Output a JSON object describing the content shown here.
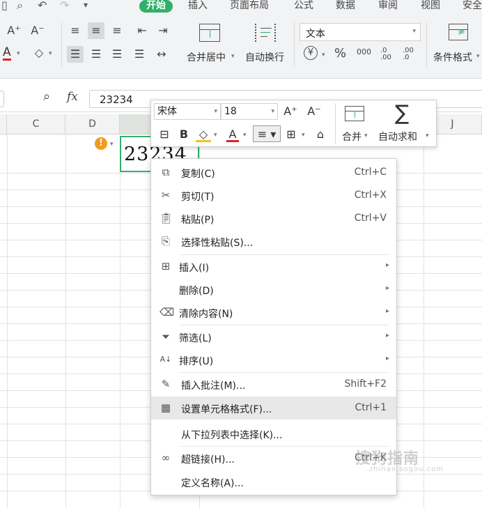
{
  "menu_bar": {
    "tabs": [
      "开始",
      "插入",
      "页面布局",
      "公式",
      "数据",
      "审阅",
      "视图",
      "安全"
    ]
  },
  "ribbon": {
    "merge_label": "合并居中",
    "wrap_label": "自动换行",
    "number_format": "文本",
    "percent": "%",
    "comma": "000",
    "inc_decimal": ".0 .00",
    "dec_decimal": ".00 .0",
    "cond_format_label": "条件格式",
    "font_color_letter": "A",
    "font_inc": "A⁺",
    "font_dec": "A⁻",
    "currency": "¥"
  },
  "formula_bar": {
    "fx": "fx",
    "value": "23234"
  },
  "columns": [
    "C",
    "D",
    "",
    "",
    "",
    "",
    "",
    "",
    "J"
  ],
  "cell": {
    "value": "23234",
    "warning": "!"
  },
  "mini_toolbar": {
    "font_name": "宋体",
    "font_size": "18",
    "merge_label": "合并",
    "autosum_label": "自动求和",
    "bold": "B",
    "font_color": "A",
    "sum_symbol": "∑"
  },
  "context_menu": {
    "items": [
      {
        "label": "复制(C)",
        "shortcut": "Ctrl+C"
      },
      {
        "label": "剪切(T)",
        "shortcut": "Ctrl+X"
      },
      {
        "label": "粘贴(P)",
        "shortcut": "Ctrl+V"
      },
      {
        "label": "选择性粘贴(S)...",
        "shortcut": ""
      },
      {
        "label": "插入(I)",
        "shortcut": ""
      },
      {
        "label": "删除(D)",
        "shortcut": ""
      },
      {
        "label": "清除内容(N)",
        "shortcut": ""
      },
      {
        "label": "筛选(L)",
        "shortcut": ""
      },
      {
        "label": "排序(U)",
        "shortcut": ""
      },
      {
        "label": "插入批注(M)...",
        "shortcut": "Shift+F2"
      },
      {
        "label": "设置单元格格式(F)...",
        "shortcut": "Ctrl+1"
      },
      {
        "label": "从下拉列表中选择(K)...",
        "shortcut": ""
      },
      {
        "label": "超链接(H)...",
        "shortcut": "Ctrl+K"
      },
      {
        "label": "定义名称(A)...",
        "shortcut": ""
      }
    ]
  },
  "watermark": {
    "text": "搜狗指南",
    "sub": "zhinan.sogou.com"
  },
  "colors": {
    "accent": "#2fb06b",
    "warning": "#f29a1e",
    "font_color_bar": "#e02020"
  }
}
